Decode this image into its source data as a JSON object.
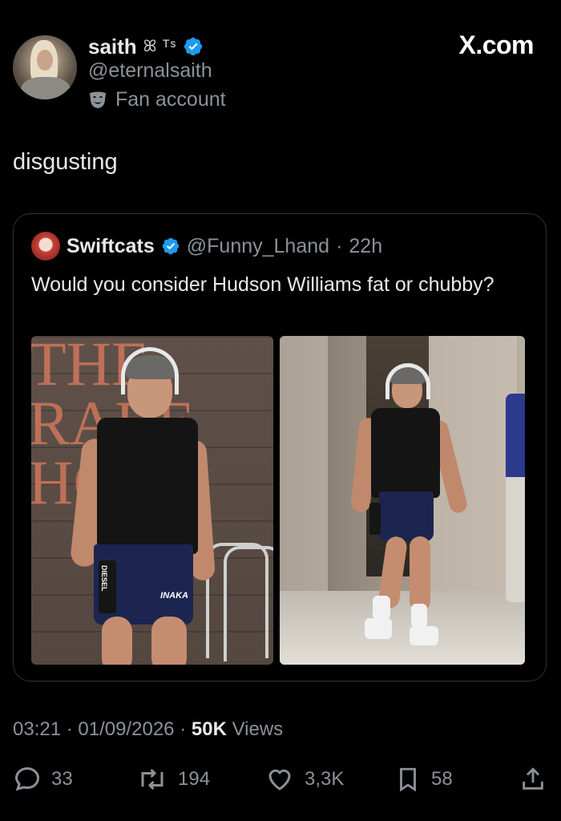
{
  "author": {
    "name": "saith",
    "name_decoration": "ꕤ ᵀˢ",
    "handle": "@eternalsaith",
    "label": "Fan account",
    "avatar_icon": "profile-photo"
  },
  "brand": "X.com",
  "tweet": {
    "text": "disgusting"
  },
  "quoted": {
    "name": "Swiftcats",
    "handle": "@Funny_Lhand",
    "separator": "·",
    "time": "22h",
    "text": "Would you consider Hudson Williams fat or chubby?",
    "photo1_sign": "THE\nRARE\nHO",
    "photo1_cup_text": "DIESEL",
    "photo1_shorts_text": "INAKA"
  },
  "meta": {
    "time": "03:21",
    "separator": "·",
    "date": "01/09/2026",
    "views_count": "50K",
    "views_label": "Views"
  },
  "actions": {
    "replies": "33",
    "reposts": "194",
    "likes": "3,3K",
    "bookmarks": "58"
  },
  "colors": {
    "verified": "#1d9bf0",
    "muted": "#8b9298",
    "background": "#000000"
  }
}
